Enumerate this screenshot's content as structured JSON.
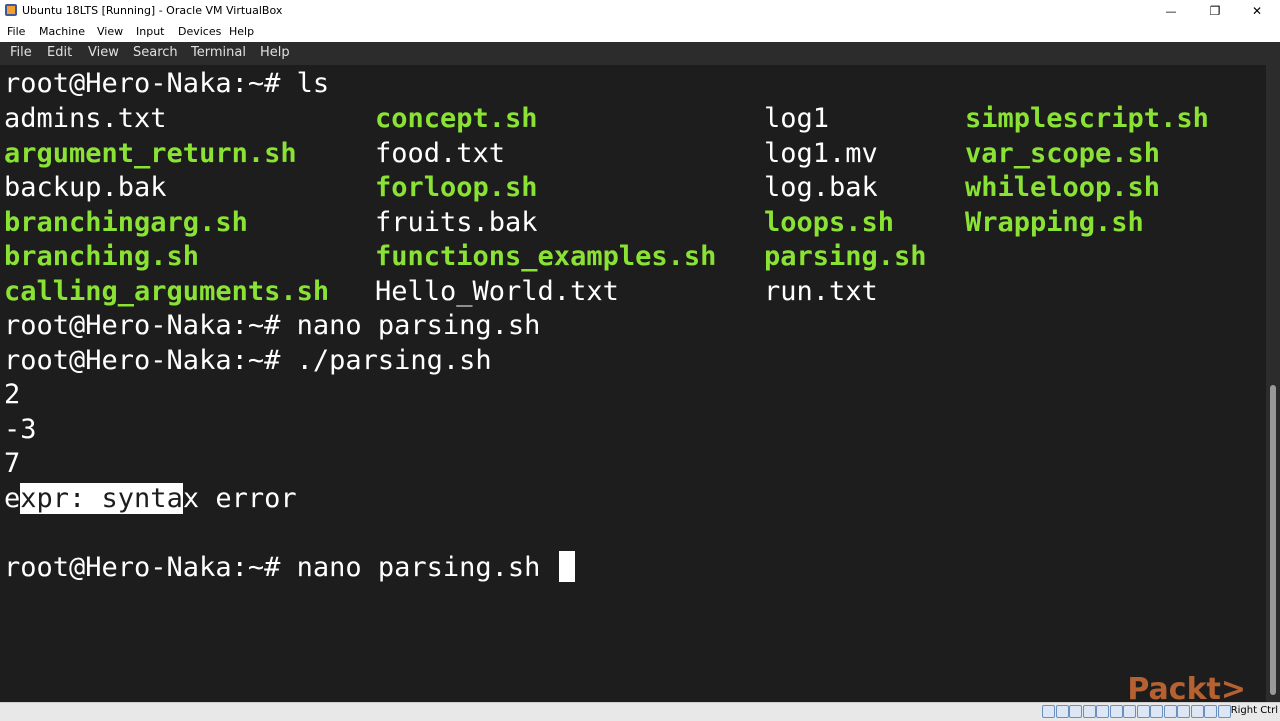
{
  "window": {
    "title": "Ubuntu 18LTS [Running] - Oracle VM VirtualBox",
    "minimize_glyph": "—",
    "maximize_glyph": "❐",
    "close_glyph": "✕"
  },
  "vbox_menu": [
    "File",
    "Machine",
    "View",
    "Input",
    "Devices",
    "Help"
  ],
  "terminal_menu": [
    "File",
    "Edit",
    "View",
    "Search",
    "Terminal",
    "Help"
  ],
  "terminal": {
    "prompt": "root@Hero-Naka:~#",
    "cmd_ls": "ls",
    "ls_rows": [
      [
        {
          "name": "admins.txt",
          "type": "plain"
        },
        {
          "name": "concept.sh",
          "type": "script"
        },
        {
          "name": "log1",
          "type": "plain"
        },
        {
          "name": "simplescript.sh",
          "type": "script"
        }
      ],
      [
        {
          "name": "argument_return.sh",
          "type": "script"
        },
        {
          "name": "food.txt",
          "type": "plain"
        },
        {
          "name": "log1.mv",
          "type": "plain"
        },
        {
          "name": "var_scope.sh",
          "type": "script"
        }
      ],
      [
        {
          "name": "backup.bak",
          "type": "plain"
        },
        {
          "name": "forloop.sh",
          "type": "script"
        },
        {
          "name": "log.bak",
          "type": "plain"
        },
        {
          "name": "whileloop.sh",
          "type": "script"
        }
      ],
      [
        {
          "name": "branchingarg.sh",
          "type": "script"
        },
        {
          "name": "fruits.bak",
          "type": "plain"
        },
        {
          "name": "loops.sh",
          "type": "script"
        },
        {
          "name": "Wrapping.sh",
          "type": "script"
        }
      ],
      [
        {
          "name": "branching.sh",
          "type": "script"
        },
        {
          "name": "functions_examples.sh",
          "type": "script"
        },
        {
          "name": "parsing.sh",
          "type": "script"
        },
        {
          "name": "",
          "type": "plain"
        }
      ],
      [
        {
          "name": "calling_arguments.sh",
          "type": "script"
        },
        {
          "name": "Hello_World.txt",
          "type": "plain"
        },
        {
          "name": "run.txt",
          "type": "plain"
        },
        {
          "name": "",
          "type": "plain"
        }
      ]
    ],
    "cmd_nano": "nano parsing.sh",
    "cmd_run": "./parsing.sh",
    "output": [
      "2",
      "-3",
      "7"
    ],
    "error": {
      "pre": "e",
      "selected": "xpr: synta",
      "post": "x error"
    },
    "cmd_final": "nano parsing.sh"
  },
  "statusbar": {
    "host_key": "Right Ctrl"
  },
  "watermark": "Packt>",
  "colors": {
    "terminal_bg": "#1d1d1d",
    "script_green": "#8ae234",
    "text": "#ffffff"
  }
}
